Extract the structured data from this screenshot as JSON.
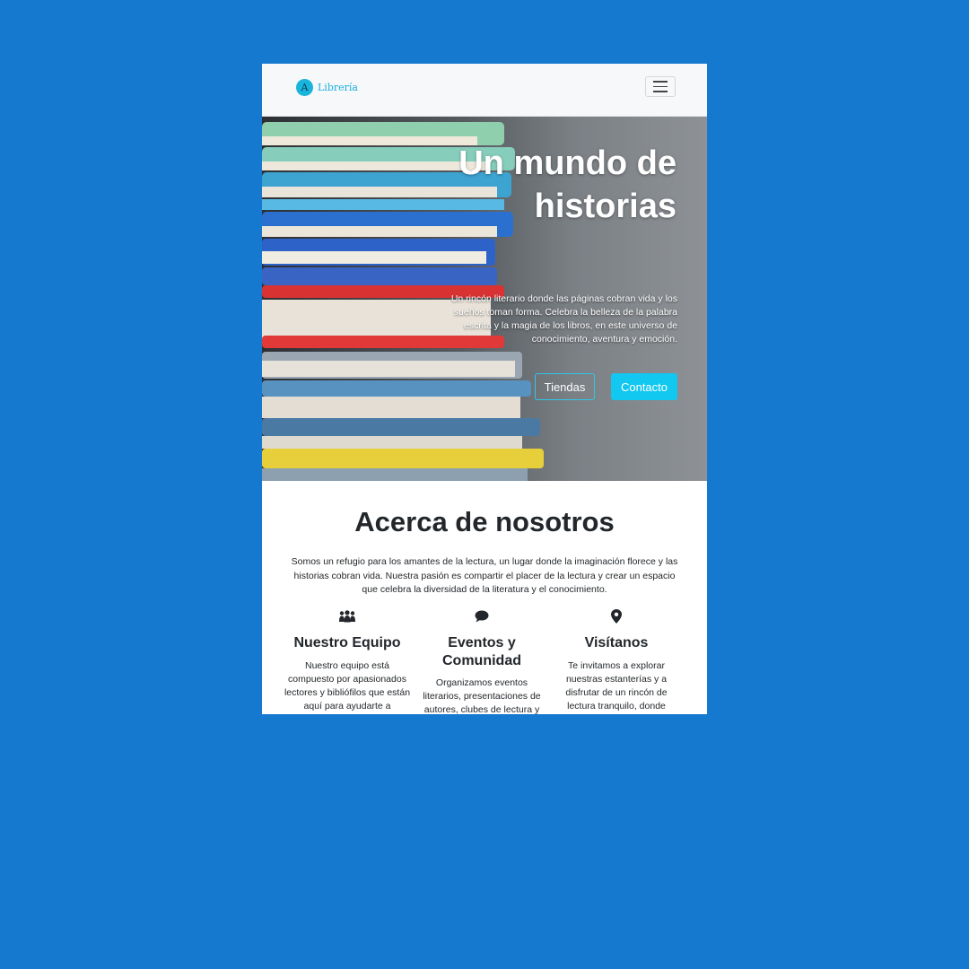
{
  "navbar": {
    "brand_letter": "A",
    "brand_name": "Librería",
    "menu_icon": "hamburger-menu-icon"
  },
  "hero": {
    "title": "Un mundo de historias",
    "text": "Un rincón literario donde las páginas cobran vida y los sueños toman forma. Celebra la belleza de la palabra escrita y la magia de los libros, en este universo de conocimiento, aventura y emoción.",
    "button_stores": "Tiendas",
    "button_contact": "Contacto",
    "accent_color": "#12c7f0"
  },
  "about": {
    "title": "Acerca de nosotros",
    "text": "Somos un refugio para los amantes de la lectura, un lugar donde la imaginación florece y las historias cobran vida. Nuestra pasión es compartir el placer de la lectura y crear un espacio que celebra la diversidad de la literatura y el conocimiento.",
    "features": [
      {
        "icon": "people-group-icon",
        "title": "Nuestro Equipo",
        "text": "Nuestro equipo está compuesto por apasionados lectores y bibliófilos que están aquí para ayudarte a"
      },
      {
        "icon": "speech-bubble-icon",
        "title": "Eventos y Comunidad",
        "text": "Organizamos eventos literarios, presentaciones de autores, clubes de lectura y"
      },
      {
        "icon": "map-pin-icon",
        "title": "Visítanos",
        "text": "Te invitamos a explorar nuestras estanterías y a disfrutar de un rincón de lectura tranquilo, donde"
      }
    ]
  }
}
